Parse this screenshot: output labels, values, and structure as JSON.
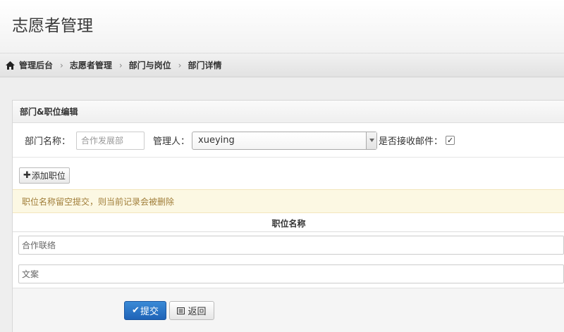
{
  "page": {
    "title": "志愿者管理"
  },
  "breadcrumb": {
    "home_icon": "home-icon",
    "items": [
      "管理后台",
      "志愿者管理",
      "部门与岗位",
      "部门详情"
    ],
    "separator": "›"
  },
  "panel": {
    "title": "部门&职位编辑",
    "department_label": "部门名称：",
    "department_placeholder": "合作发展部",
    "manager_label": "管理人：",
    "manager_value": "xueying",
    "email_label": "是否接收邮件：",
    "email_checked": true,
    "add_position_label": "添加职位",
    "notice": "职位名称留空提交，则当前记录会被删除",
    "column_header": "职位名称",
    "positions": [
      "合作联络",
      "文案"
    ]
  },
  "actions": {
    "submit_label": "提交",
    "back_label": "返回"
  },
  "colors": {
    "accent": "#2a74c6",
    "notice_bg": "#fcf8e3",
    "notice_text": "#a07d38"
  }
}
